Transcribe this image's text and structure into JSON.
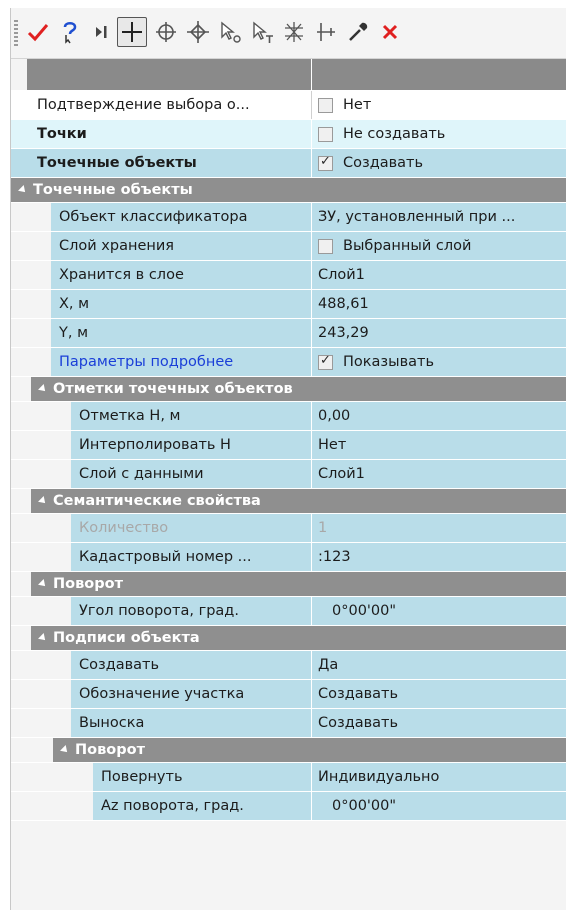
{
  "toolbar": {
    "buttons": [
      {
        "name": "apply-icon",
        "color": "#e02020"
      },
      {
        "name": "help-select-icon",
        "color": "#1f4fd0"
      },
      {
        "name": "step-icon",
        "color": "#444444"
      },
      {
        "name": "crosshair-icon",
        "color": "#333333"
      },
      {
        "name": "circle-cross-icon",
        "color": "#555555"
      },
      {
        "name": "snap-cross-icon",
        "color": "#555555"
      },
      {
        "name": "select-cursor-o-icon",
        "color": "#555555"
      },
      {
        "name": "select-cursor-t-icon",
        "color": "#555555"
      },
      {
        "name": "snap-grid-icon",
        "color": "#555555"
      },
      {
        "name": "measure-icon",
        "color": "#555555"
      },
      {
        "name": "pipette-icon",
        "color": "#555555"
      },
      {
        "name": "close-icon",
        "color": "#e02020"
      }
    ]
  },
  "rows": {
    "confirm": {
      "label": "Подтверждение выбора о...",
      "value": "Нет"
    },
    "points": {
      "label": "Точки",
      "value": "Не создавать"
    },
    "point_objects": {
      "label": "Точечные объекты",
      "value": "Создавать"
    }
  },
  "sec_point_objects": {
    "title": "Точечные объекты",
    "classifier": {
      "label": "Объект классификатора",
      "value": "ЗУ, установленный при ..."
    },
    "storage_layer": {
      "label": "Слой хранения",
      "value": "Выбранный слой"
    },
    "stored_in": {
      "label": "Хранится в слое",
      "value": "Слой1"
    },
    "x": {
      "label": "X, м",
      "value": "488,61"
    },
    "y": {
      "label": "Y, м",
      "value": "243,29"
    },
    "params": {
      "label": "Параметры подробнее",
      "value": "Показывать"
    }
  },
  "sec_marks": {
    "title": "Отметки точечных объектов",
    "mark_h": {
      "label": "Отметка H, м",
      "value": "0,00"
    },
    "interp": {
      "label": "Интерполировать H",
      "value": "Нет"
    },
    "data_layer": {
      "label": "Слой с данными",
      "value": "Слой1"
    }
  },
  "sec_semantic": {
    "title": "Семантические свойства",
    "count": {
      "label": "Количество",
      "value": "1"
    },
    "cadastral": {
      "label": "Кадастровый номер ...",
      "value": ":123"
    }
  },
  "sec_rotation": {
    "title": "Поворот",
    "angle": {
      "label": "Угол поворота, град.",
      "value": "0°00'00\""
    }
  },
  "sec_labels": {
    "title": "Подписи объекта",
    "create": {
      "label": "Создавать",
      "value": "Да"
    },
    "designation": {
      "label": "Обозначение участка",
      "value": "Создавать"
    },
    "callout": {
      "label": "Выноска",
      "value": "Создавать"
    }
  },
  "sec_labels_rotation": {
    "title": "Поворот",
    "rotate": {
      "label": "Повернуть",
      "value": "Индивидуально"
    },
    "az": {
      "label": "Az поворота, град.",
      "value": "0°00'00\""
    }
  },
  "checkboxes": {
    "confirm": false,
    "points": false,
    "point_objects": true,
    "storage_layer": false,
    "params": true
  },
  "colors": {
    "header_gray": "#8a8a8a",
    "row_blue": "#b9dde9",
    "row_cyan": "#dff5fa",
    "link_blue": "#1a3fd8"
  }
}
